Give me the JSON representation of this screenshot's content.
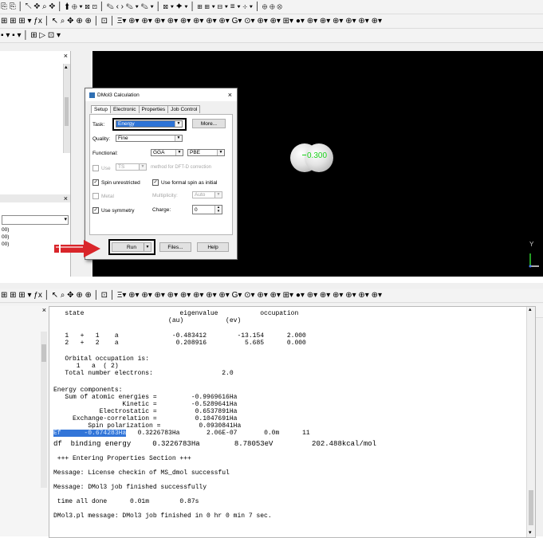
{
  "top_window": {
    "toolbar_row1": "⎘ ⎘ │ ↖ ✥ ⌕ ✥ │ ⬆ ⊕ ▾ ⊠ ⊡ │ ✎ ‹ › ✎ ▾ ✎ ▾ │ ⊠ ▾ ✦ ▾ │ ⊞ ⊞ ▾ ⊟ ▾ ≡ ▾ ⊹ ▾ │ ⊕ ⊕ ⊗",
    "toolbar_row2": "⊞ ⊞ ⊞ ▾ ƒx │ ↖ ⌕ ✥ ⊕ ⊕ │ ⊡ │ Ξ▾ ⊕▾ ⊕▾ ⊕▾ ⊕▾ ⊕▾ ⊕▾ ⊕▾ ⊕▾ G▾ ⊙▾ ⊕▾ ⊕▾ ⊞▾ ●▾ ⊕▾ ⊕▾ ⊕▾ ⊕▾ ⊕▾ ⊕▾",
    "toolbar_row3": "▪ ▾ ▪ ▾ │ ⊞ ▷ ⊡ ▾",
    "left_panel": {
      "close_glyph": "×",
      "mid_close_glyph": "×",
      "combo_arrow": "▾",
      "scroll_up": "▴",
      "rows": [
        "00)",
        "00)",
        "00)"
      ]
    },
    "viewport": {
      "atom_label": "0.300",
      "axis_y": "Y"
    },
    "dialog": {
      "title": "DMol3 Calculation",
      "close": "×",
      "tabs": [
        "Setup",
        "Electronic",
        "Properties",
        "Job Control"
      ],
      "task_label": "Task:",
      "task_value": "Energy",
      "more_button": "More...",
      "quality_label": "Quality:",
      "quality_value": "Fine",
      "functional_label": "Functional:",
      "functional_value1": "GGA",
      "functional_value2": "PBE",
      "use_label": "Use",
      "use_value": "TS",
      "dftd_text": "method for DFT-D correction",
      "spin_unrestricted": "Spin unrestricted",
      "use_formal_spin": "Use formal spin as initial",
      "metal_label": "Metal",
      "multiplicity_label": "Multiplicity:",
      "multiplicity_value": "Auto",
      "use_symmetry": "Use symmetry",
      "charge_label": "Charge:",
      "charge_value": "0",
      "run_button": "Run",
      "files_button": "Files...",
      "help_button": "Help"
    }
  },
  "bottom_window": {
    "toolbar_row1": "⊞ ⊞ ⊞ ▾ ƒx │ ↖ ⌕ ✥ ⊕ ⊕ │ ⊡ │ Ξ▾ ⊕▾ ⊕▾ ⊕▾ ⊕▾ ⊕▾ ⊕▾ ⊕▾ ⊕▾ G▾ ⊙▾ ⊕▾ ⊕▾ ⊞▾ ●▾ ⊕▾ ⊕▾ ⊕▾ ⊕▾ ⊕▾ ⊕▾",
    "toolbar_row2": "⊞ ▷ ⊡ ▾",
    "side_close": "×",
    "console_lines": [
      "   state                         eigenvalue           occupation",
      "                              (au)           (ev)",
      "",
      "   1   +   1    a              -0.483412        -13.154      2.000",
      "   2   +   2    a               0.208916          5.685      0.000",
      "",
      "   Orbital occupation is:",
      "      1   a  ( 2)",
      "   Total number electrons:                  2.0",
      "",
      "Energy components:",
      "   Sum of atomic energies =         -0.9969616Ha",
      "                  Kinetic =         -0.5289641Ha",
      "            Electrostatic =          0.6537891Ha",
      "     Exchange-correlation =          0.1047691Ha",
      "         Spin polarization =          0.0930841Ha",
      "",
      "df  binding energy     0.3226783Ha        8.78053eV         202.488kcal/mol",
      "",
      " +++ Entering Properties Section +++",
      "",
      "Message: License checkin of MS_dmol successful",
      "",
      "Message: DMol3 job finished successfully",
      "",
      " time all done      0.01m        0.87s",
      "",
      "DMol3.pl message: DMol3 job finished in 0 hr 0 min 7 sec."
    ],
    "ef_line": {
      "label": "Ef",
      "value": "      -0.674283Ha",
      "rest": "   0.3226783Ha       2.06E-07       0.0m      11"
    }
  },
  "colors": {
    "viewport_bg": "#000000",
    "highlight": "#3275d8",
    "arrow": "#d9252a",
    "label_green": "#19d219"
  }
}
